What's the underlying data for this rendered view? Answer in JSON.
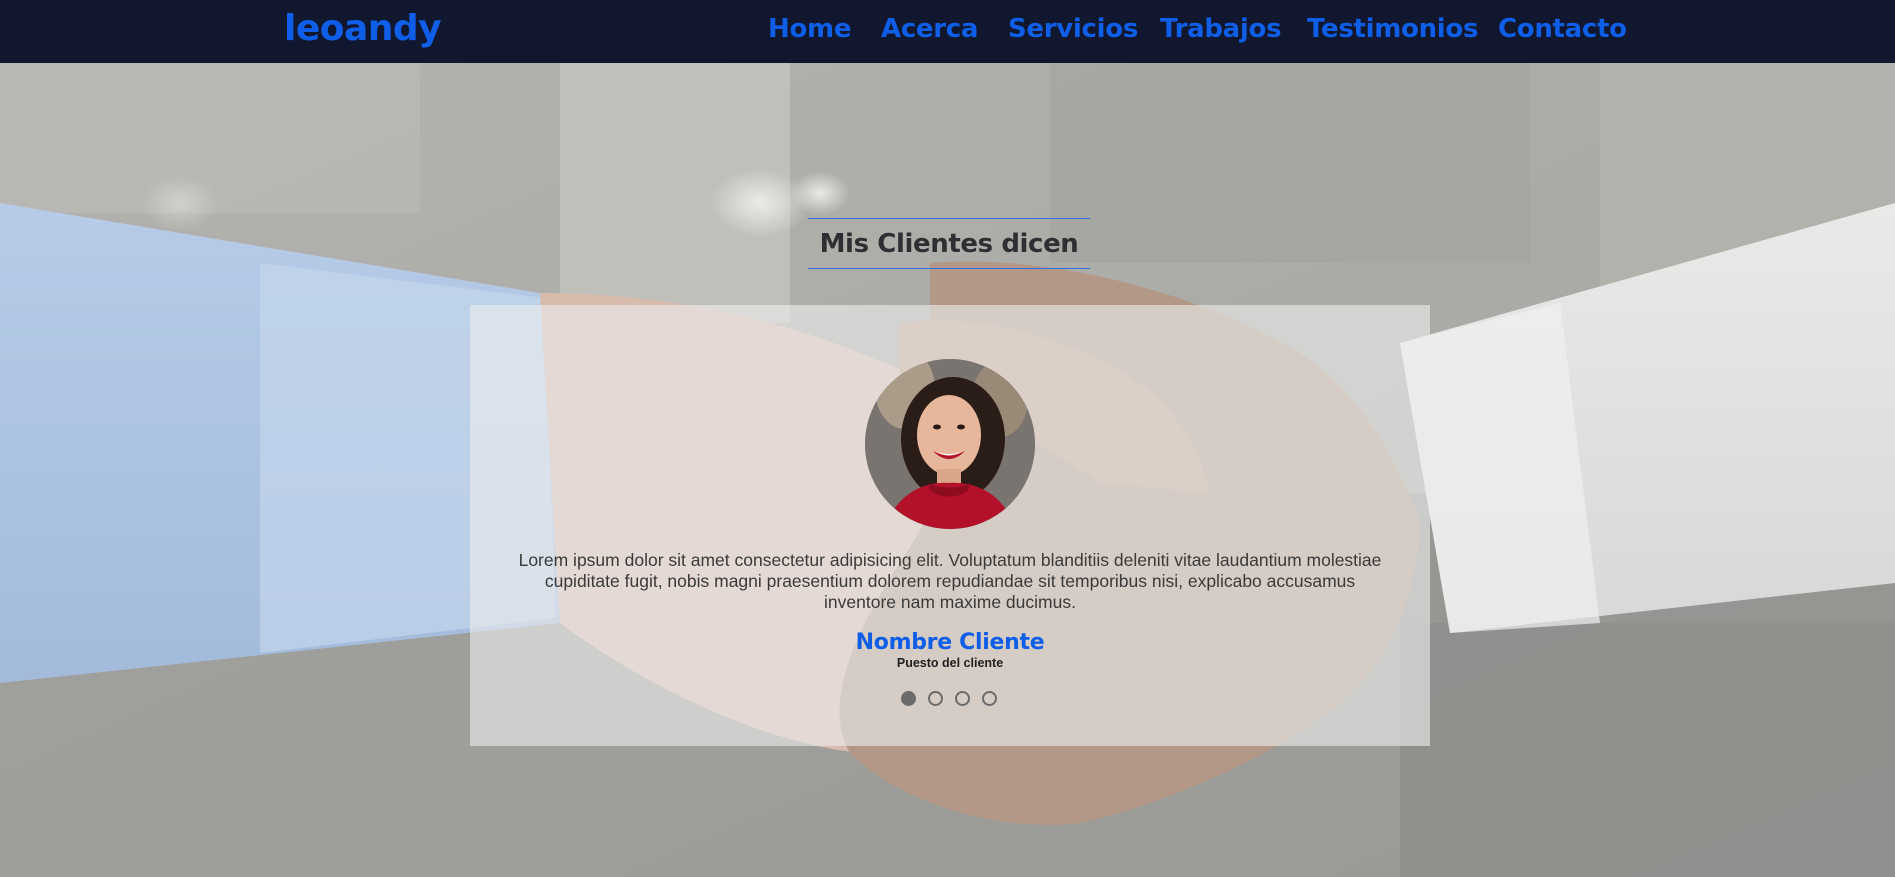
{
  "navbar": {
    "brand": "leoandy",
    "links": [
      {
        "label": "Home",
        "key": "home"
      },
      {
        "label": "Acerca",
        "key": "acerca"
      },
      {
        "label": "Servicios",
        "key": "servicios"
      },
      {
        "label": "Trabajos",
        "key": "trabajos"
      },
      {
        "label": "Testimonios",
        "key": "testimonios"
      },
      {
        "label": "Contacto",
        "key": "contacto"
      }
    ]
  },
  "testimonials": {
    "title": "Mis Clientes dicen",
    "active_index": 0,
    "slide_count": 4,
    "current": {
      "quote": "Lorem ipsum dolor sit amet consectetur adipisicing elit. Voluptatum blanditiis deleniti vitae laudantium molestiae cupiditate fugit, nobis magni praesentium dolorem repudiandae sit temporibus nisi, explicabo accusamus inventore nam maxime ducimus.",
      "name": "Nombre Cliente",
      "role": "Puesto del cliente"
    }
  },
  "colors": {
    "navbar_bg": "#11172f",
    "accent": "#0f5ee8",
    "title_text": "#2f2f33",
    "dot": "#6b6b6b"
  }
}
